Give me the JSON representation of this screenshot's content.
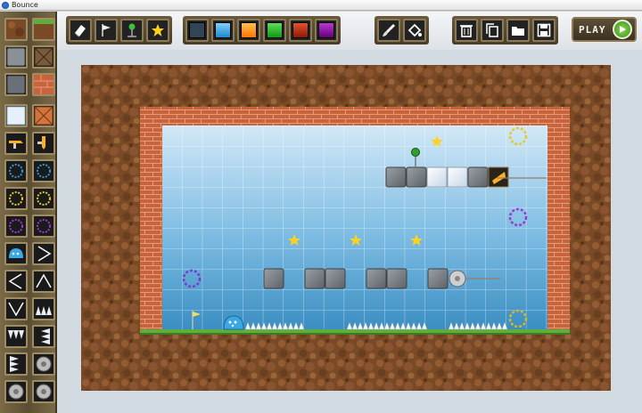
{
  "window": {
    "title": "Bounce"
  },
  "toolbar": {
    "tools": [
      "eraser-icon",
      "flag-icon",
      "checkpoint-icon",
      "star-icon"
    ],
    "colors": [
      "#334455",
      "#39a9e6",
      "#ff8a00",
      "#22aa2a",
      "#bb2a12",
      "#8a0e9a"
    ],
    "actions": [
      "brush-icon",
      "fill-icon"
    ],
    "file": [
      "delete-icon",
      "copy-icon",
      "folder-icon",
      "save-icon"
    ],
    "play_label": "PLAY"
  },
  "palette": {
    "tiles": [
      "dirt-tile",
      "grass-tile",
      "stone-tile",
      "crate-tile",
      "stone-dark-tile",
      "brick-tile",
      "ice-tile",
      "orange-crate-tile",
      "cannon-left-tile",
      "cannon-down-tile",
      "portal-blue-tile",
      "portal-blue-2-tile",
      "portal-yellow-tile",
      "portal-yellow-2-tile",
      "portal-purple-tile",
      "portal-purple-2-tile",
      "player-tile",
      "arrow-right-tile",
      "arrow-left-tile",
      "arrow-up-tile",
      "arrow-down-tile",
      "spikes-up-tile",
      "spikes-down-tile",
      "spikes-left-tile",
      "spikes-right-tile",
      "saw-tile",
      "saw-2-tile",
      "saw-3-tile"
    ]
  },
  "colors": {
    "dirt": "#7a4a26",
    "brick": "#c8643c",
    "sky_top": "#c8e0f5",
    "sky_bottom": "#3a94c6",
    "grass": "#5fae3c"
  }
}
